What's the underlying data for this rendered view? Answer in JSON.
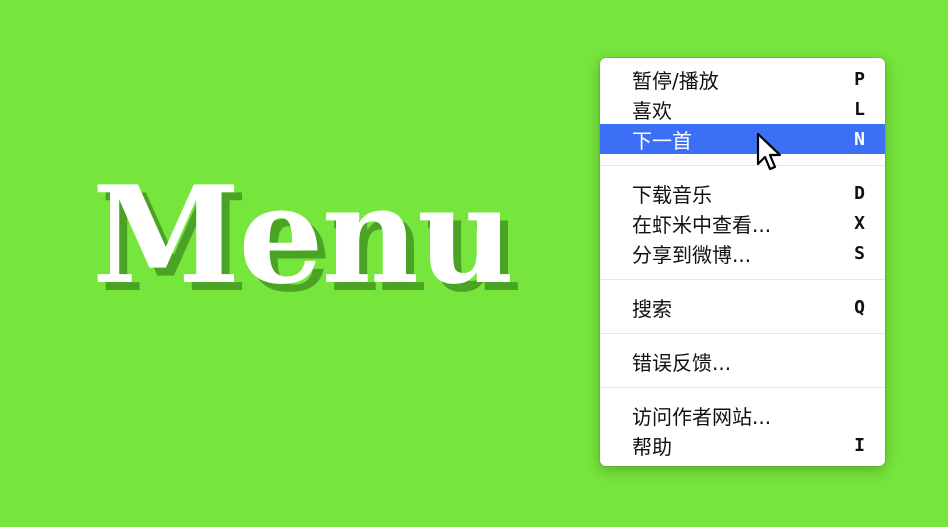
{
  "title": "Menu",
  "colors": {
    "background": "#76e53c",
    "selection": "#3b6ff5",
    "menu_background": "#ffffff"
  },
  "menu": {
    "groups": [
      [
        {
          "name": "menu-item-pause-play",
          "label": "暂停/播放",
          "shortcut": "P",
          "selected": false
        },
        {
          "name": "menu-item-like",
          "label": "喜欢",
          "shortcut": "L",
          "selected": false
        },
        {
          "name": "menu-item-next-track",
          "label": "下一首",
          "shortcut": "N",
          "selected": true
        }
      ],
      [
        {
          "name": "menu-item-download-music",
          "label": "下载音乐",
          "shortcut": "D",
          "selected": false
        },
        {
          "name": "menu-item-view-in-xiami",
          "label": "在虾米中查看...",
          "shortcut": "X",
          "selected": false
        },
        {
          "name": "menu-item-share-to-weibo",
          "label": "分享到微博...",
          "shortcut": "S",
          "selected": false
        }
      ],
      [
        {
          "name": "menu-item-search",
          "label": "搜索",
          "shortcut": "Q",
          "selected": false
        }
      ],
      [
        {
          "name": "menu-item-feedback",
          "label": "错误反馈...",
          "shortcut": "",
          "selected": false
        }
      ],
      [
        {
          "name": "menu-item-visit-author-site",
          "label": "访问作者网站...",
          "shortcut": "",
          "selected": false
        },
        {
          "name": "menu-item-help",
          "label": "帮助",
          "shortcut": "I",
          "selected": false
        }
      ]
    ]
  },
  "cursor_icon": "arrow-pointer-icon"
}
